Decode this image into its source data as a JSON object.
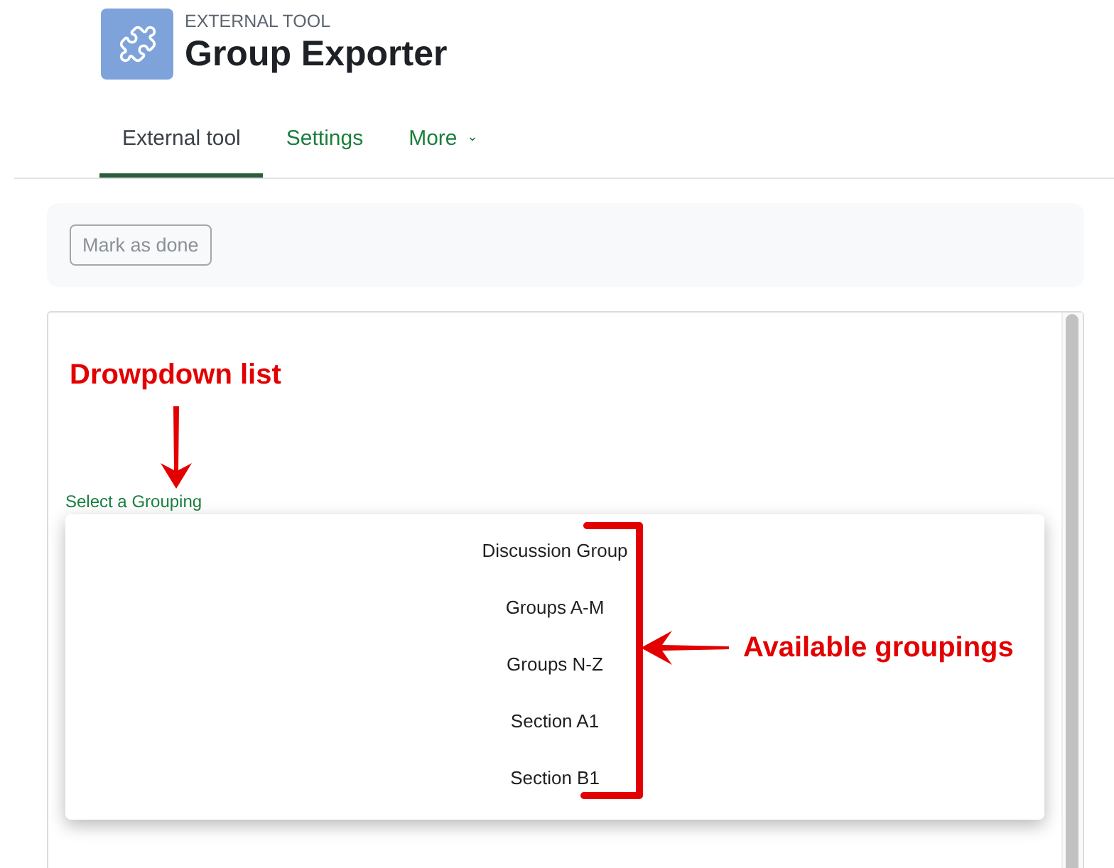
{
  "header": {
    "eyebrow": "EXTERNAL TOOL",
    "title": "Group Exporter"
  },
  "tabs": [
    {
      "label": "External tool",
      "selected": true,
      "menu": false
    },
    {
      "label": "Settings",
      "selected": false,
      "menu": false
    },
    {
      "label": "More",
      "selected": false,
      "menu": true
    }
  ],
  "completion": {
    "button": "Mark as done"
  },
  "tool_frame": {
    "select_label": "Select a Grouping",
    "options": [
      {
        "label": "Discussion Group",
        "selected": false
      },
      {
        "label": "Groups A-M",
        "selected": false
      },
      {
        "label": "Groups N-Z",
        "selected": false
      },
      {
        "label": "Section A1",
        "selected": false
      },
      {
        "label": "Section B1",
        "selected": false
      }
    ]
  },
  "annotations": [
    {
      "kind": "arrow_down",
      "text": "Drowpdown list"
    },
    {
      "kind": "bracket",
      "text": "Available groupings"
    }
  ]
}
